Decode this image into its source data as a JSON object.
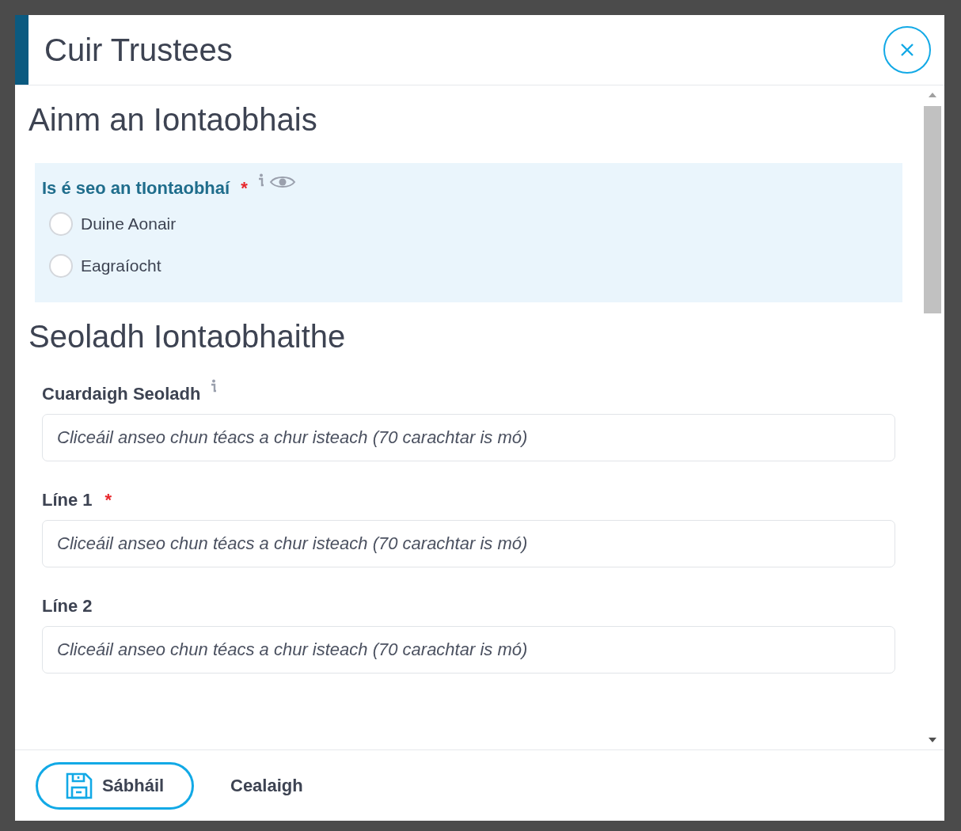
{
  "dialog": {
    "title": "Cuir Trustees"
  },
  "sections": [
    {
      "heading": "Ainm an Iontaobhais",
      "fields": [
        {
          "kind": "radio",
          "label": "Is é seo an tIontaobhaí",
          "required": true,
          "info": true,
          "preview": true,
          "options": [
            {
              "label": "Duine Aonair",
              "selected": false
            },
            {
              "label": "Eagraíocht",
              "selected": false
            }
          ]
        }
      ]
    },
    {
      "heading": "Seoladh Iontaobhaithe",
      "fields": [
        {
          "kind": "text",
          "label": "Cuardaigh Seoladh",
          "required": false,
          "info": true,
          "placeholder": "Cliceáil anseo chun téacs a chur isteach (70 carachtar is mó)"
        },
        {
          "kind": "text",
          "label": "Líne 1",
          "required": true,
          "info": false,
          "placeholder": "Cliceáil anseo chun téacs a chur isteach (70 carachtar is mó)"
        },
        {
          "kind": "text",
          "label": "Líne 2",
          "required": false,
          "info": false,
          "placeholder": "Cliceáil anseo chun téacs a chur isteach (70 carachtar is mó)"
        }
      ]
    }
  ],
  "footer": {
    "save": "Sábháil",
    "cancel": "Cealaigh"
  },
  "required_mark": "*"
}
